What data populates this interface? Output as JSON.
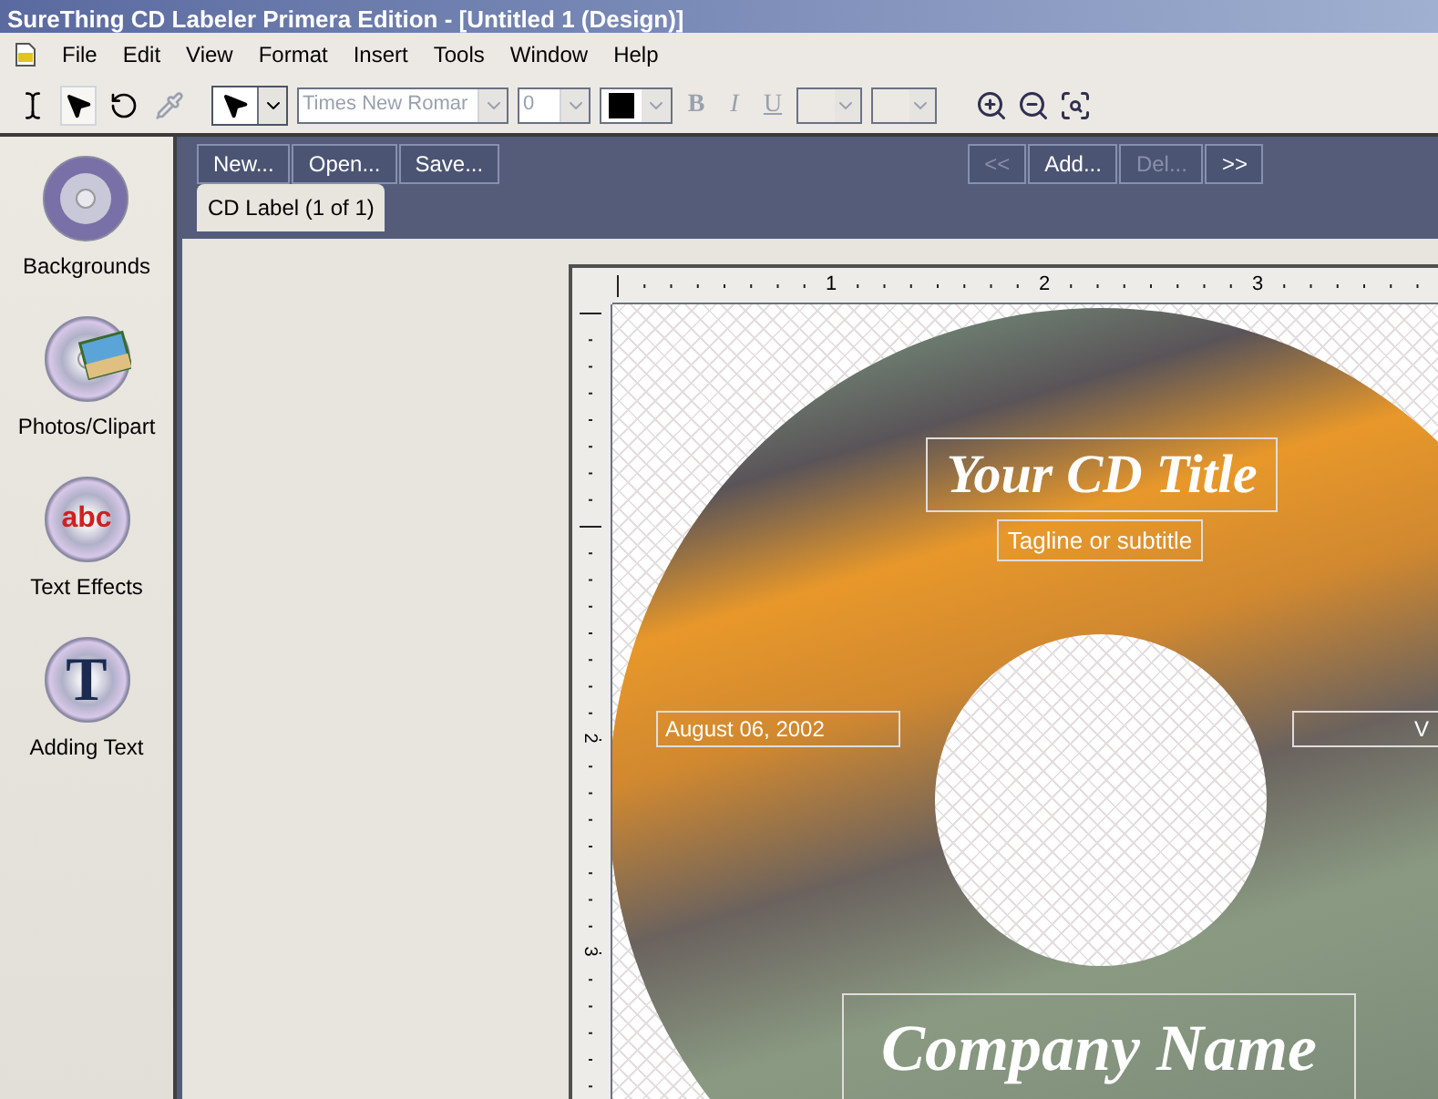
{
  "window": {
    "title": "SureThing CD Labeler Primera Edition - [Untitled 1 (Design)]"
  },
  "menu": [
    "File",
    "Edit",
    "View",
    "Format",
    "Insert",
    "Tools",
    "Window",
    "Help"
  ],
  "toolbar": {
    "tools": [
      {
        "kind": "text",
        "selected": false
      },
      {
        "kind": "pointer",
        "selected": true
      },
      {
        "kind": "rotate",
        "selected": false
      },
      {
        "kind": "dropper",
        "selected": false
      }
    ],
    "font": {
      "value": "Times New Romar",
      "disabled": true
    },
    "size": {
      "value": "0",
      "disabled": true
    },
    "styles": [
      {
        "label": "B",
        "kind": "bold",
        "disabled": true
      },
      {
        "label": "I",
        "kind": "italic",
        "disabled": true
      },
      {
        "label": "U",
        "kind": "underline",
        "disabled": true
      }
    ]
  },
  "sidebar": {
    "items": [
      {
        "label": "Backgrounds",
        "kind": "disc"
      },
      {
        "label": "Photos/Clipart",
        "kind": "photo"
      },
      {
        "label": "Text Effects",
        "kind": "letters",
        "icon_text": "abc"
      },
      {
        "label": "Adding Text",
        "kind": "letter",
        "icon_text": "T"
      }
    ]
  },
  "actions": [
    {
      "label": "New...",
      "disabled": false
    },
    {
      "label": "Open...",
      "disabled": false
    },
    {
      "label": "Save...",
      "disabled": false
    }
  ],
  "navigation": [
    {
      "label": "<<",
      "disabled": true
    },
    {
      "label": "Add...",
      "disabled": false
    },
    {
      "label": "Del...",
      "disabled": true
    },
    {
      "label": ">>",
      "disabled": false
    }
  ],
  "tabs": [
    {
      "label": "CD Label (1 of 1)",
      "selected": true
    }
  ],
  "rulers": {
    "horizontal": [
      "1",
      "2",
      "3"
    ],
    "vertical": [
      "2",
      "3"
    ]
  },
  "label_fields": [
    {
      "text": "Your CD Title",
      "kind": "script"
    },
    {
      "text": "Tagline or subtitle",
      "kind": "tagline"
    },
    {
      "text": "August 06, 2002",
      "kind": "date"
    },
    {
      "text": "V",
      "kind": "right"
    },
    {
      "text": "Company Name",
      "kind": "company"
    }
  ]
}
